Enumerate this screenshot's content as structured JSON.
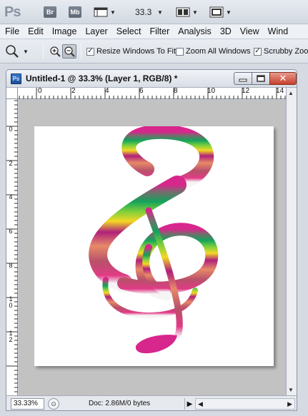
{
  "app": {
    "logo": "Ps",
    "bridge_label": "Br",
    "minibridge_label": "Mb",
    "zoom_value": "33.3"
  },
  "menu": {
    "items": [
      "File",
      "Edit",
      "Image",
      "Layer",
      "Select",
      "Filter",
      "Analysis",
      "3D",
      "View",
      "Wind"
    ]
  },
  "options": {
    "resize_windows_label": "Resize Windows To Fit",
    "resize_windows_checked": true,
    "zoom_all_label": "Zoom All Windows",
    "zoom_all_checked": false,
    "scrubby_label": "Scrubby Zoom",
    "scrubby_checked": true
  },
  "document": {
    "icon_label": "Ps",
    "title": "Untitled-1 @ 33.3% (Layer 1, RGB/8) *",
    "ruler_top_labels": [
      "0",
      "2",
      "4",
      "6",
      "8",
      "10",
      "12",
      "14"
    ],
    "ruler_left_labels": [
      "0",
      "2",
      "4",
      "6",
      "8",
      "10",
      "12"
    ],
    "status_zoom": "33.33%",
    "doc_info": "Doc: 2.86M/0 bytes"
  },
  "colors": {
    "clef_top": "#d7268c",
    "clef_green": "#13a35b",
    "clef_yellow": "#f3d824",
    "clef_magenta": "#b0207a",
    "clef_salmon": "#e68a68",
    "close_button": "#c6402c"
  }
}
